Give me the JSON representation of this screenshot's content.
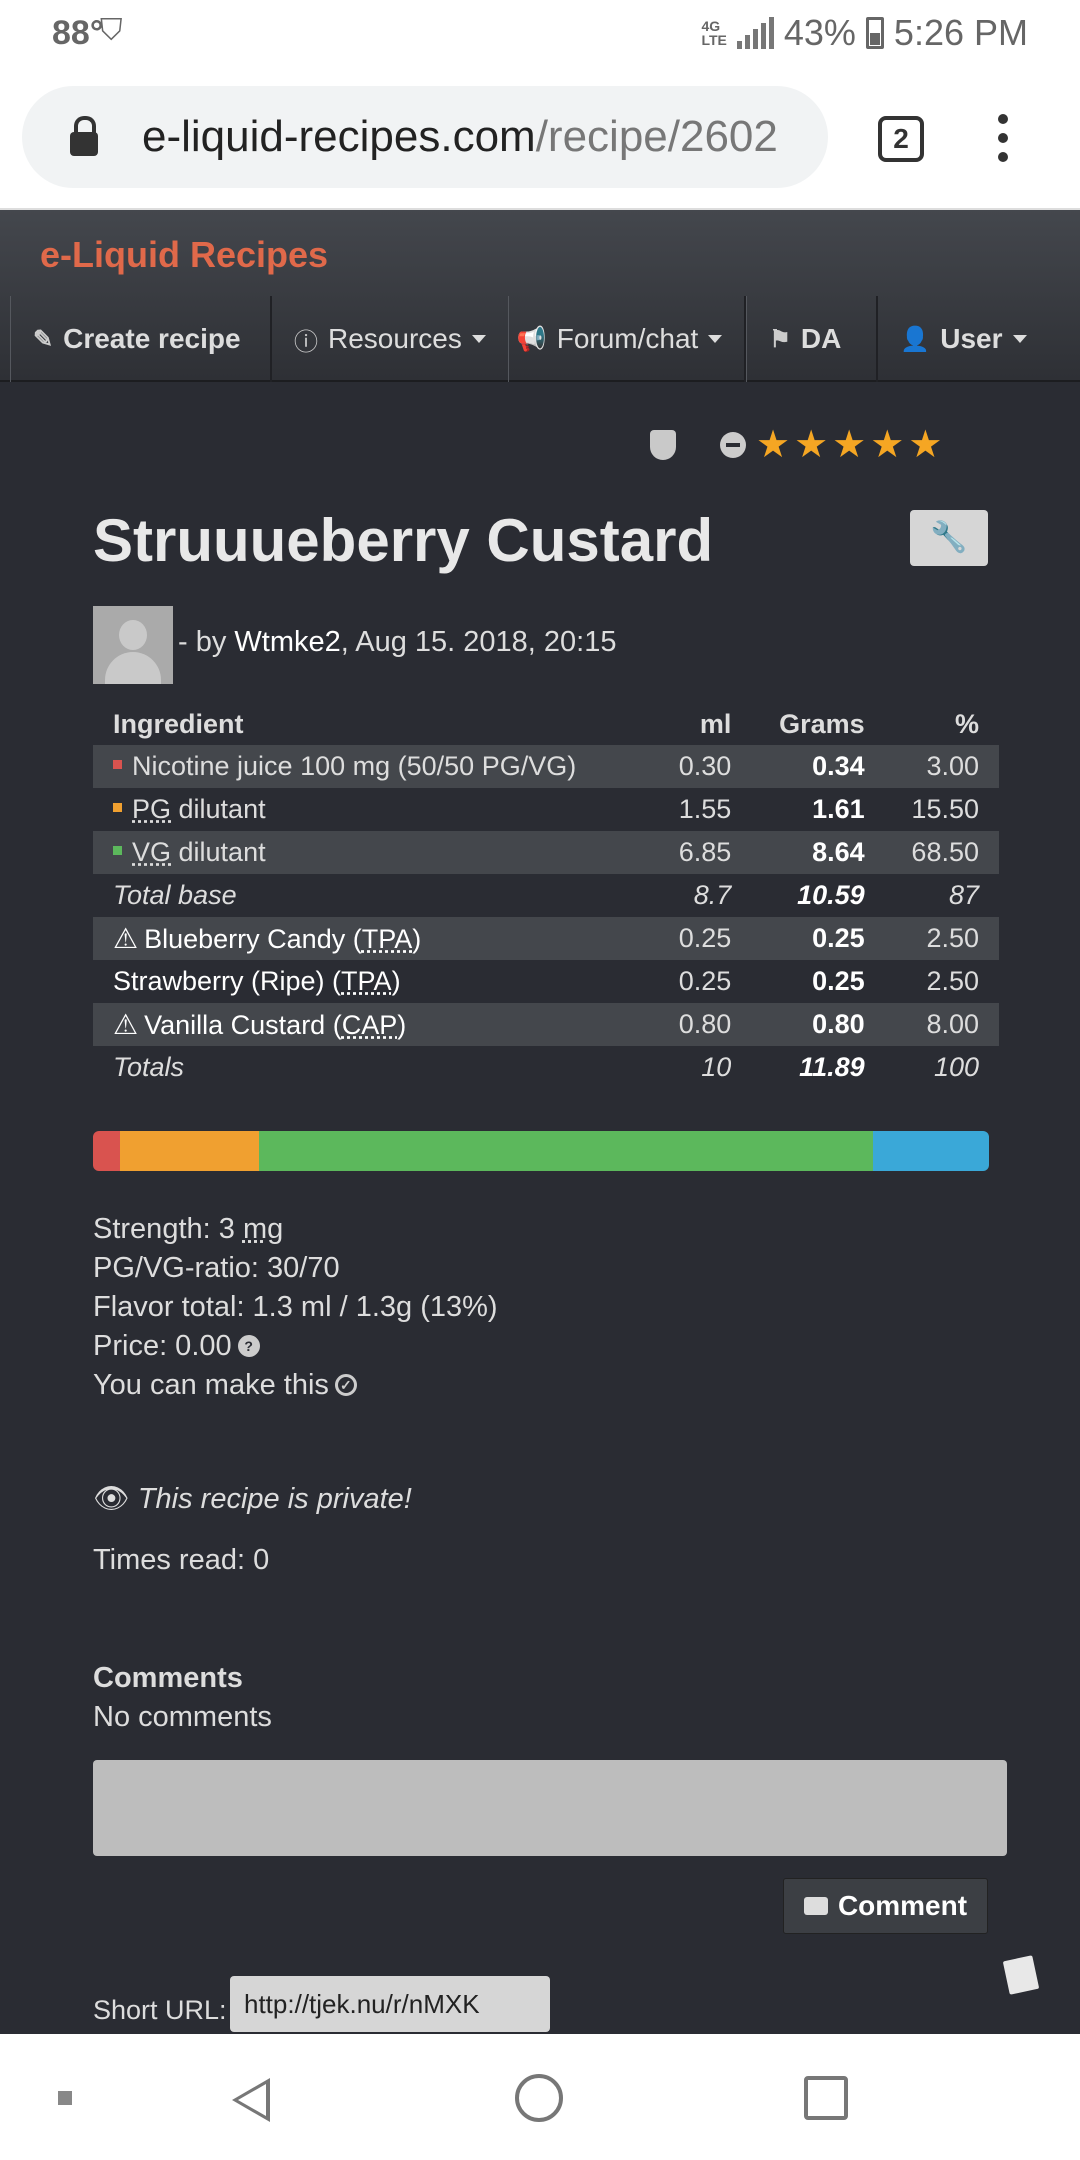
{
  "status": {
    "temp": "88°",
    "battery": "43%",
    "time": "5:26 PM",
    "network": "4G LTE"
  },
  "browser": {
    "url_domain": "e-liquid-recipes.com",
    "url_path": "/recipe/2602",
    "tab_count": "2"
  },
  "site": {
    "brand": "e-Liquid Recipes",
    "nav": {
      "create": "Create recipe",
      "resources": "Resources",
      "forum": "Forum/chat",
      "da": "DA",
      "user": "User"
    }
  },
  "recipe": {
    "title": "Struuueberry Custard",
    "by_prefix": "- by ",
    "author": "Wtmke2",
    "date": ", Aug 15. 2018, 20:15",
    "rating_stars": 5
  },
  "table": {
    "headers": {
      "ingredient": "Ingredient",
      "ml": "ml",
      "grams": "Grams",
      "pct": "%"
    },
    "rows": {
      "nic": {
        "name": "Nicotine juice 100 mg (50/50 PG/VG)",
        "ml": "0.30",
        "grams": "0.34",
        "pct": "3.00",
        "color": "#d9534f"
      },
      "pg": {
        "abbr": "PG",
        "rest": " dilutant",
        "ml": "1.55",
        "grams": "1.61",
        "pct": "15.50",
        "color": "#f0a030"
      },
      "vg": {
        "abbr": "VG",
        "rest": " dilutant",
        "ml": "6.85",
        "grams": "8.64",
        "pct": "68.50",
        "color": "#5cb85c"
      },
      "base": {
        "name": "Total base",
        "ml": "8.7",
        "grams": "10.59",
        "pct": "87"
      },
      "f1": {
        "name": "Blueberry Candy (",
        "abbr": "TPA",
        "close": ")",
        "ml": "0.25",
        "grams": "0.25",
        "pct": "2.50"
      },
      "f2": {
        "name": "Strawberry (Ripe) (",
        "abbr": "TPA",
        "close": ")",
        "ml": "0.25",
        "grams": "0.25",
        "pct": "2.50"
      },
      "f3": {
        "name": "Vanilla Custard (",
        "abbr": "CAP",
        "close": ")",
        "ml": "0.80",
        "grams": "0.80",
        "pct": "8.00"
      },
      "totals": {
        "name": "Totals",
        "ml": "10",
        "grams": "11.89",
        "pct": "100"
      }
    }
  },
  "mixbar": {
    "segments": [
      {
        "name": "nicotine",
        "percent": 3,
        "color": "#d9534f"
      },
      {
        "name": "pg",
        "percent": 15.5,
        "color": "#f0a030"
      },
      {
        "name": "vg",
        "percent": 68.5,
        "color": "#5cb85c"
      },
      {
        "name": "flavor",
        "percent": 13,
        "color": "#3aa8d8"
      }
    ]
  },
  "stats": {
    "strength_label": "Strength: 3 ",
    "strength_unit": "mg",
    "ratio": "PG/VG-ratio: 30/70",
    "flavor_total": "Flavor total: 1.3 ml / 1.3g (13%)",
    "price": "Price: 0.00",
    "can_make": "You can make this"
  },
  "private_notice": "This recipe is private!",
  "times_read": "Times read: 0",
  "comments": {
    "heading": "Comments",
    "empty": "No comments",
    "button": "Comment"
  },
  "short_url": {
    "label": "Short URL:",
    "value": "http://tjek.nu/r/nMXK"
  }
}
